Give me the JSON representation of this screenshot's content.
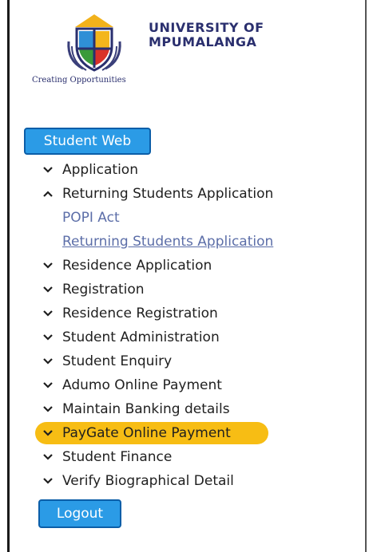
{
  "colors": {
    "text": "#1f1f1f",
    "link": "#5c6ea8",
    "button_bg": "#2b9be6",
    "button_border": "#0b5ea8",
    "highlight": "#f7bd14",
    "university_name": "#2a2f6e"
  },
  "header": {
    "university_line1": "UNIVERSITY OF",
    "university_line2": "MPUMALANGA",
    "tagline": "Creating Opportunities",
    "crest_icon": "university-crest-icon"
  },
  "student_web_button": "Student Web",
  "menu": {
    "application": "Application",
    "returning_students": "Returning Students Application",
    "returning_sub": {
      "popi": "POPI Act",
      "returning_app": "Returning Students Application"
    },
    "residence_application": "Residence Application",
    "registration": "Registration",
    "residence_registration": "Residence Registration",
    "student_administration": "Student Administration",
    "student_enquiry": "Student Enquiry",
    "adumo_payment": "Adumo Online Payment",
    "maintain_banking": "Maintain Banking details",
    "paygate_payment": "PayGate Online Payment",
    "student_finance": "Student Finance",
    "verify_biographical": "Verify Biographical Detail"
  },
  "logout_button": "Logout"
}
